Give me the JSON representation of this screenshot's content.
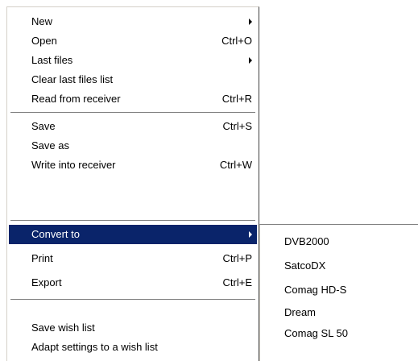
{
  "menu": {
    "items": [
      {
        "label": "New",
        "shortcut": "",
        "submenu": true
      },
      {
        "label": "Open",
        "shortcut": "Ctrl+O"
      },
      {
        "label": "Last files",
        "shortcut": "",
        "submenu": true
      },
      {
        "label": "Clear last files list",
        "shortcut": ""
      },
      {
        "label": "Read from receiver",
        "shortcut": "Ctrl+R"
      },
      {
        "label": "Save",
        "shortcut": "Ctrl+S"
      },
      {
        "label": "Save as",
        "shortcut": ""
      },
      {
        "label": "Write into receiver",
        "shortcut": "Ctrl+W"
      },
      {
        "label": "Convert to",
        "shortcut": "",
        "submenu": true,
        "highlighted": true
      },
      {
        "label": "Print",
        "shortcut": "Ctrl+P"
      },
      {
        "label": "Export",
        "shortcut": "Ctrl+E"
      },
      {
        "label": "Save wish list",
        "shortcut": ""
      },
      {
        "label": "Adapt settings to a wish list",
        "shortcut": ""
      }
    ]
  },
  "submenu": {
    "items": [
      {
        "label": "DVB2000"
      },
      {
        "label": "SatcoDX"
      },
      {
        "label": "Comag HD-S"
      },
      {
        "label": "Dream"
      },
      {
        "label": "Comag SL 50"
      }
    ]
  },
  "colors": {
    "highlight": "#0a246a",
    "highlight_text": "#ffffff"
  }
}
